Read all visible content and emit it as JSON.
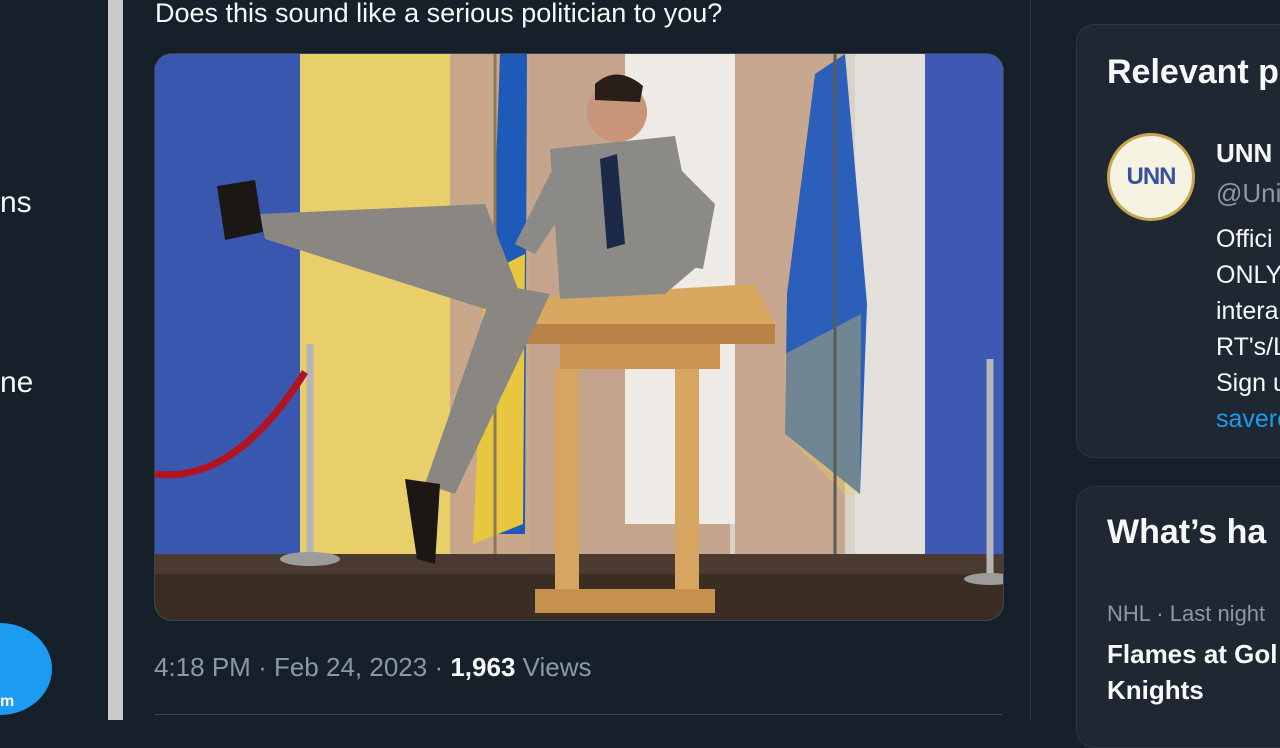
{
  "left_nav": {
    "fragment_1": "ns",
    "fragment_2": "ne",
    "post_fragment": "m"
  },
  "tweet": {
    "text": "Does this sound like a serious politician to you?",
    "image_alt": "Man in grey suit kicking a leg over a wooden podium in front of blue and yellow flags",
    "time": "4:18 PM",
    "separator": "·",
    "date": "Feb 24, 2023",
    "views_count": "1,963",
    "views_label": "Views"
  },
  "relevant": {
    "heading": "Relevant p",
    "avatar_text": "UNN",
    "name": "UNN",
    "handle": "@Uni",
    "bio_lines": [
      "Offici",
      "ONLY",
      "intera",
      "RT's/L",
      "Sign u"
    ],
    "bio_link": "savere"
  },
  "whats_happening": {
    "heading": "What’s ha",
    "trend_meta": "NHL · Last night",
    "trend_title_1": "Flames at Gol",
    "trend_title_2": "Knights"
  },
  "colors": {
    "background": "#15202b",
    "accent": "#1d9bf0",
    "text_primary": "#f7f9f9",
    "text_secondary": "#8b98a5"
  }
}
